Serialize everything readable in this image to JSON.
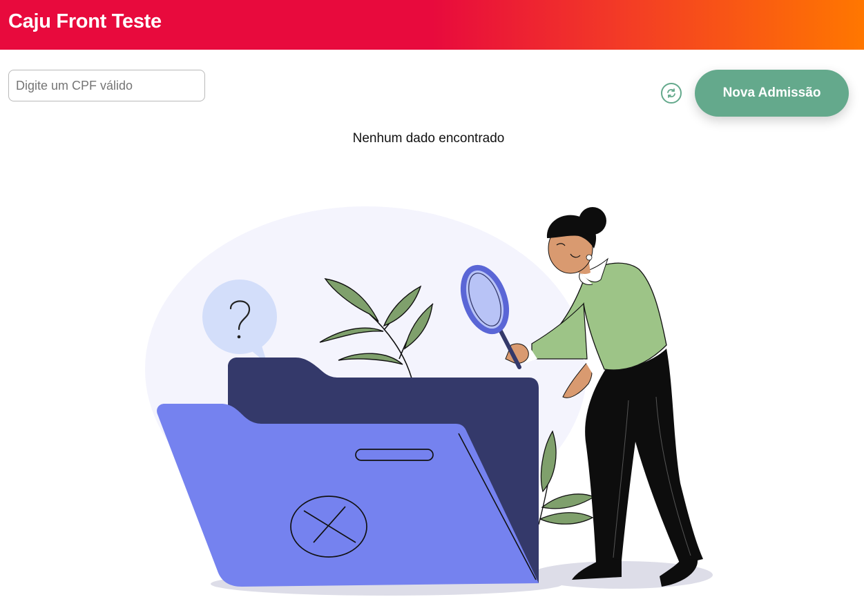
{
  "header": {
    "title": "Caju Front Teste",
    "gradient": [
      "#e80a3d",
      "#ff7700"
    ]
  },
  "toolbar": {
    "search_placeholder": "Digite um CPF válido",
    "search_value": "",
    "refresh_icon": "refresh-icon",
    "new_admission_label": "Nova Admissão",
    "accent_color": "#64a98c"
  },
  "empty_state": {
    "message": "Nenhum dado encontrado",
    "illustration": "empty-folder-search-illustration"
  }
}
